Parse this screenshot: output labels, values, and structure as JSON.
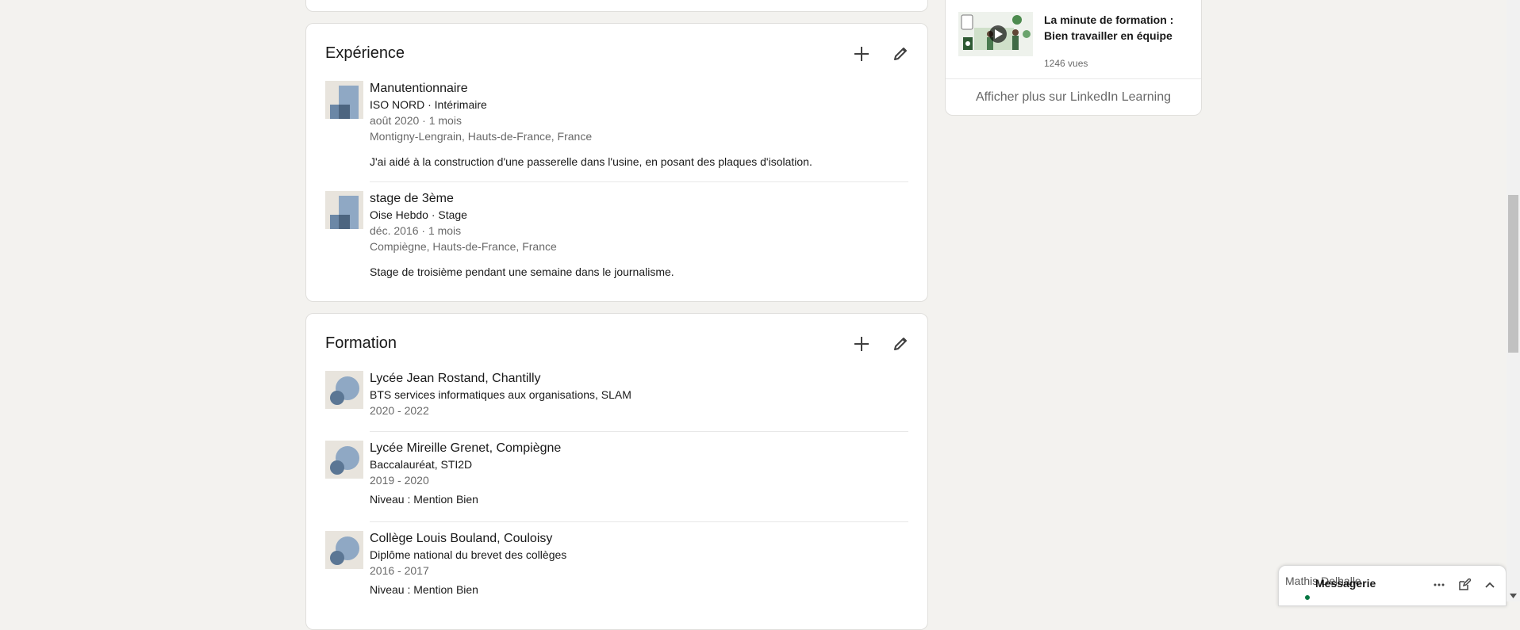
{
  "experience": {
    "title": "Expérience",
    "add_label": "Ajouter une expérience",
    "edit_label": "Modifier l'expérience",
    "items": [
      {
        "title": "Manutentionnaire",
        "company": "ISO NORD · Intérimaire",
        "dates": "août 2020 · 1 mois",
        "location": "Montigny-Lengrain, Hauts-de-France, France",
        "description": "J'ai aidé à la construction d'une passerelle dans l'usine, en posant des plaques d'isolation."
      },
      {
        "title": "stage de 3ème",
        "company": "Oise Hebdo · Stage",
        "dates": "déc. 2016 · 1 mois",
        "location": "Compiègne, Hauts-de-France, France",
        "description": "Stage de troisième pendant une semaine dans le journalisme."
      }
    ]
  },
  "education": {
    "title": "Formation",
    "items": [
      {
        "school": "Lycée Jean Rostand, Chantilly",
        "degree": "BTS services informatiques aux organisations, SLAM",
        "dates": "2020 - 2022",
        "grade": ""
      },
      {
        "school": "Lycée Mireille Grenet, Compiègne",
        "degree": "Baccalauréat, STI2D",
        "dates": "2019 - 2020",
        "grade": "Niveau : Mention Bien"
      },
      {
        "school": "Collège Louis Bouland, Couloisy",
        "degree": "Diplôme national du brevet des collèges",
        "dates": "2016 - 2017",
        "grade": "Niveau : Mention Bien"
      }
    ]
  },
  "learning": {
    "course_title": "La minute de formation : Bien travailler en équipe",
    "views": "1246 vues",
    "more_link": "Afficher plus sur LinkedIn Learning"
  },
  "messaging": {
    "avatar_alt": "Mathis Delhalle",
    "label": "Messagerie"
  },
  "colors": {
    "page_bg": "#f3f2ef",
    "card_bg": "#ffffff",
    "logo_blue": "#8fa8c4",
    "logo_dark": "#5b7694",
    "online_green": "#057642"
  }
}
